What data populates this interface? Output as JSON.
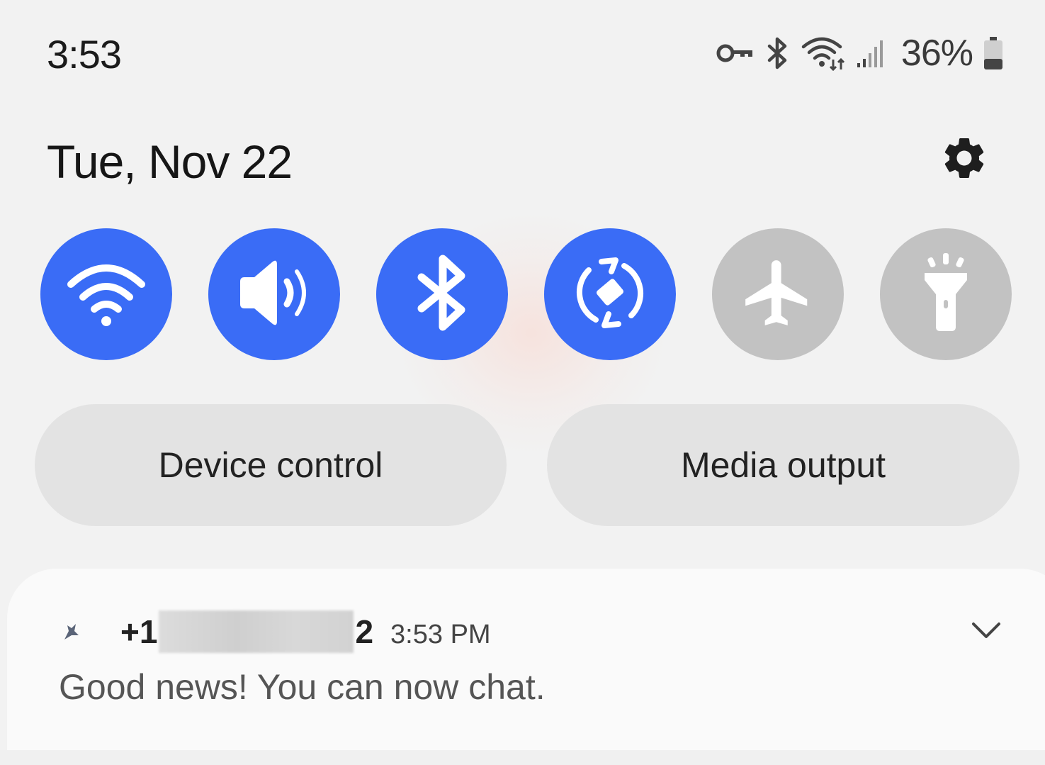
{
  "status_bar": {
    "time": "3:53",
    "battery_percent": "36%",
    "battery_level": 0.36,
    "icons": [
      "vpn-key-icon",
      "bluetooth-icon",
      "wifi-icon",
      "signal-icon",
      "battery-icon"
    ]
  },
  "header": {
    "date": "Tue, Nov 22",
    "settings_icon": "gear-icon"
  },
  "quick_toggles": [
    {
      "name": "Wi-Fi",
      "icon": "wifi-icon",
      "state": "on"
    },
    {
      "name": "Sound",
      "icon": "volume-icon",
      "state": "on"
    },
    {
      "name": "Bluetooth",
      "icon": "bluetooth-icon",
      "state": "on"
    },
    {
      "name": "Auto rotate",
      "icon": "rotate-icon",
      "state": "on"
    },
    {
      "name": "Airplane mode",
      "icon": "airplane-icon",
      "state": "off"
    },
    {
      "name": "Flashlight",
      "icon": "flashlight-icon",
      "state": "off"
    }
  ],
  "buttons": {
    "device_control": "Device control",
    "media_output": "Media output"
  },
  "notification": {
    "sender_prefix": "+1",
    "sender_suffix": "2",
    "time": "3:53 PM",
    "message": "Good news! You can now chat.",
    "app_icon": "messages-app-icon",
    "expand_icon": "chevron-down-icon"
  },
  "colors": {
    "accent": "#3a6cf6",
    "tile_off": "#c2c2c2",
    "background": "#f2f2f2",
    "pill": "#e3e3e3"
  }
}
